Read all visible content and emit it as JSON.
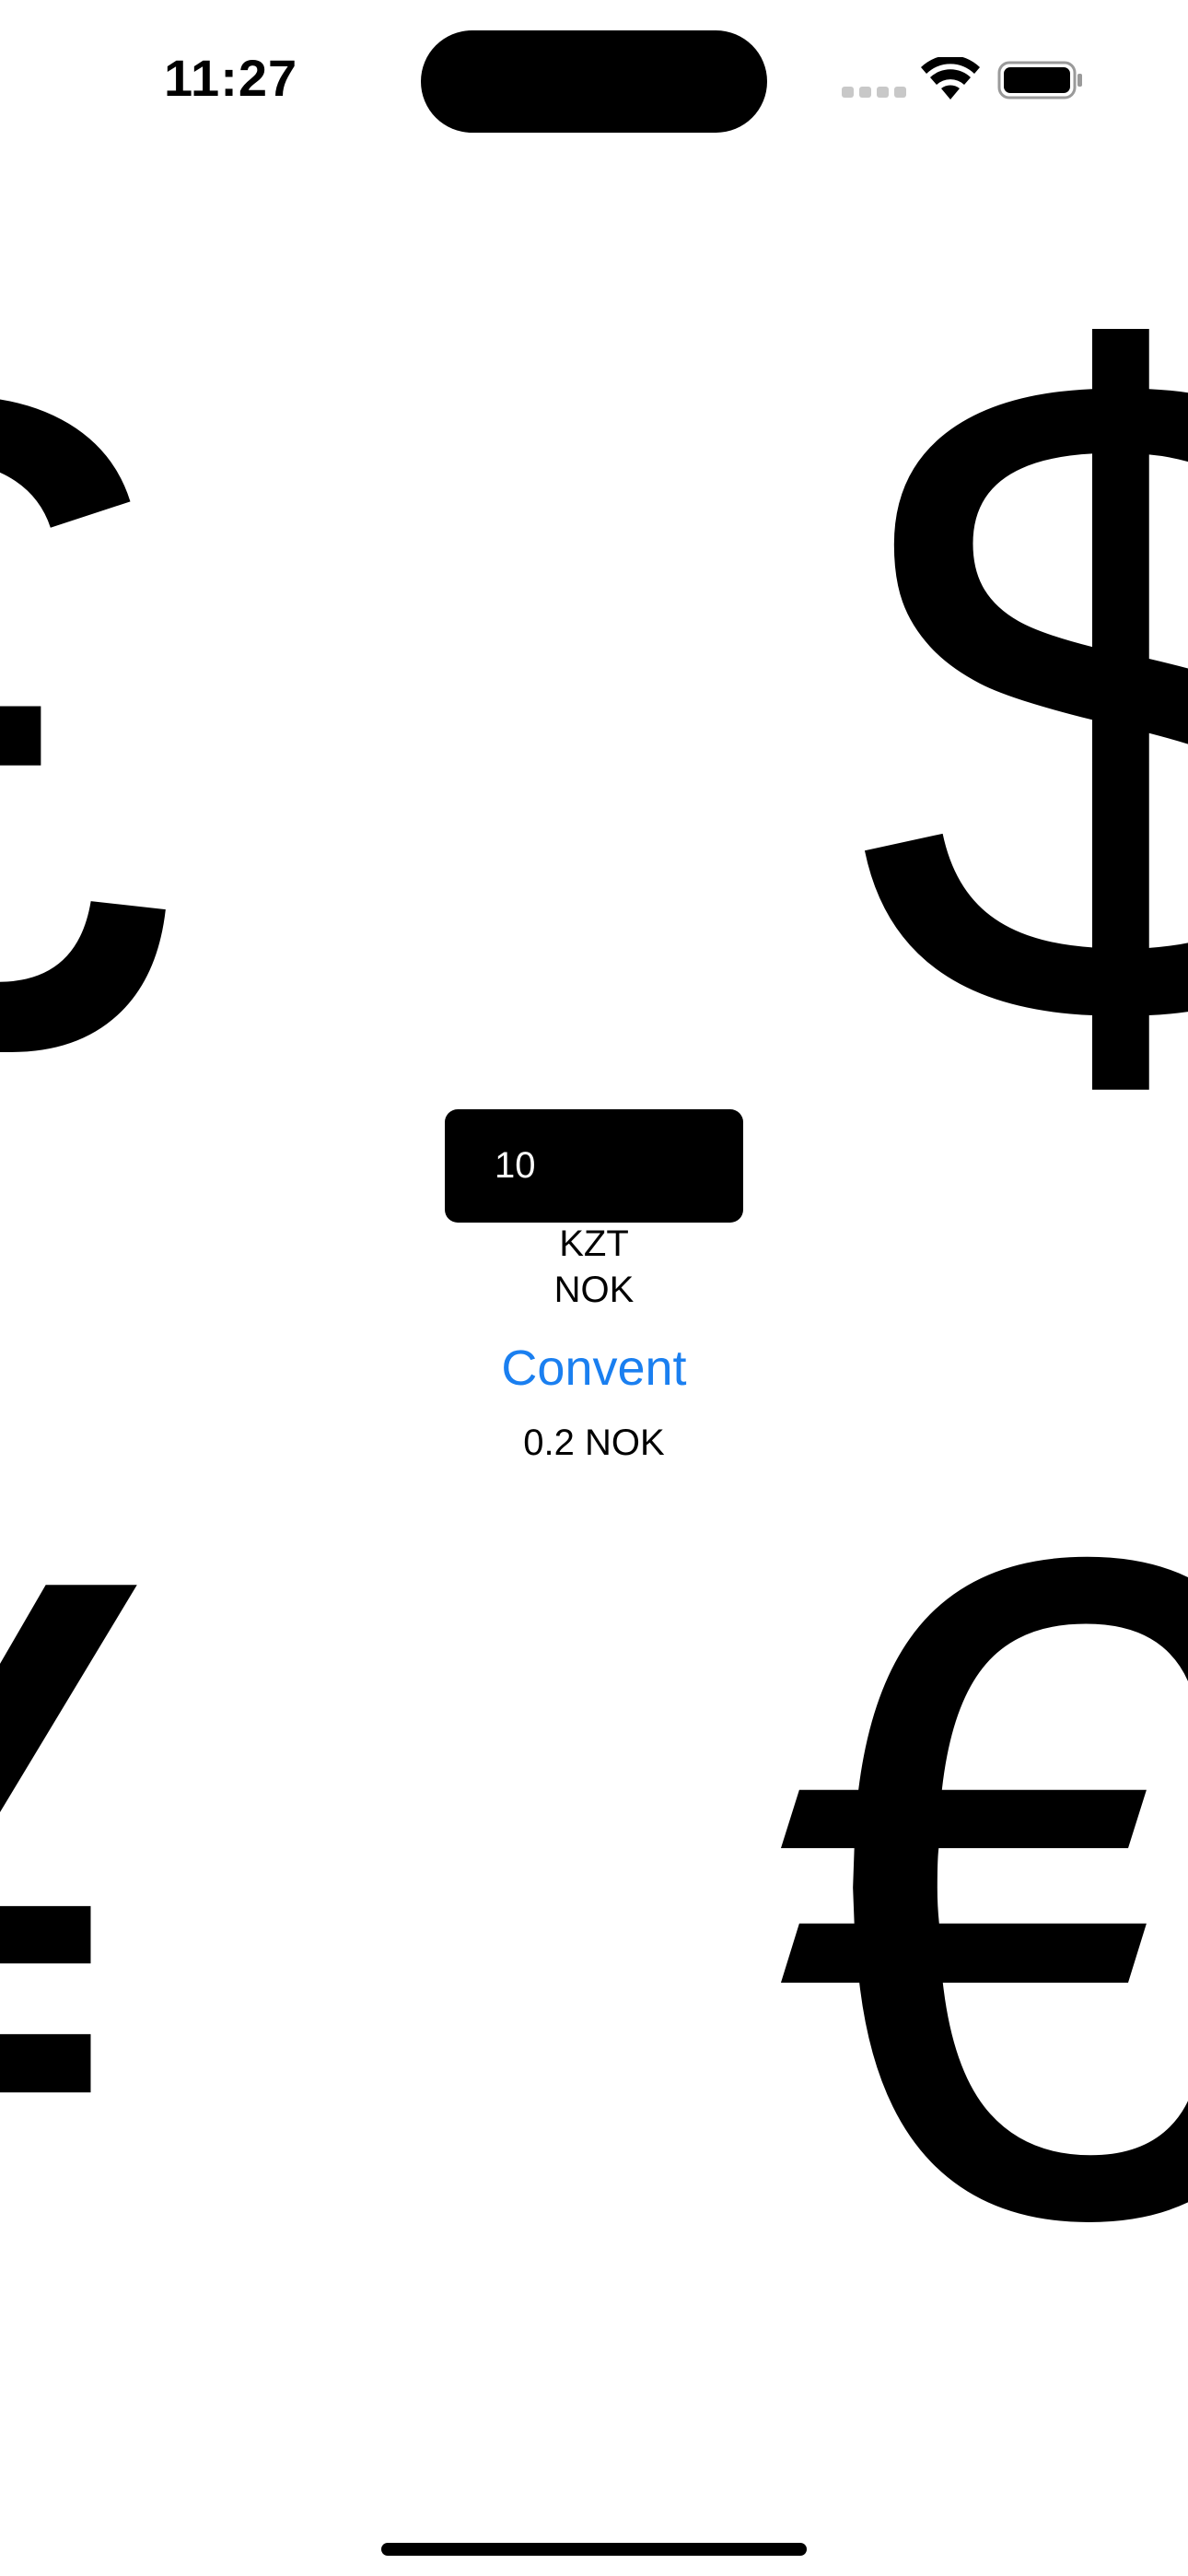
{
  "status_bar": {
    "time": "11:27",
    "icons": [
      "cellular-signal-icon",
      "wifi-icon",
      "battery-icon"
    ]
  },
  "background_symbols": {
    "pound": "£",
    "dollar": "$",
    "yen": "¥",
    "euro": "€"
  },
  "converter": {
    "amount_value": "10",
    "from_currency": "KZT",
    "to_currency": "NOK",
    "convert_button_label": "Convent",
    "result": "0.2 NOK"
  },
  "colors": {
    "accent": "#1a7ff0",
    "input_background": "#000000",
    "input_text": "#ffffff",
    "background": "#ffffff"
  }
}
